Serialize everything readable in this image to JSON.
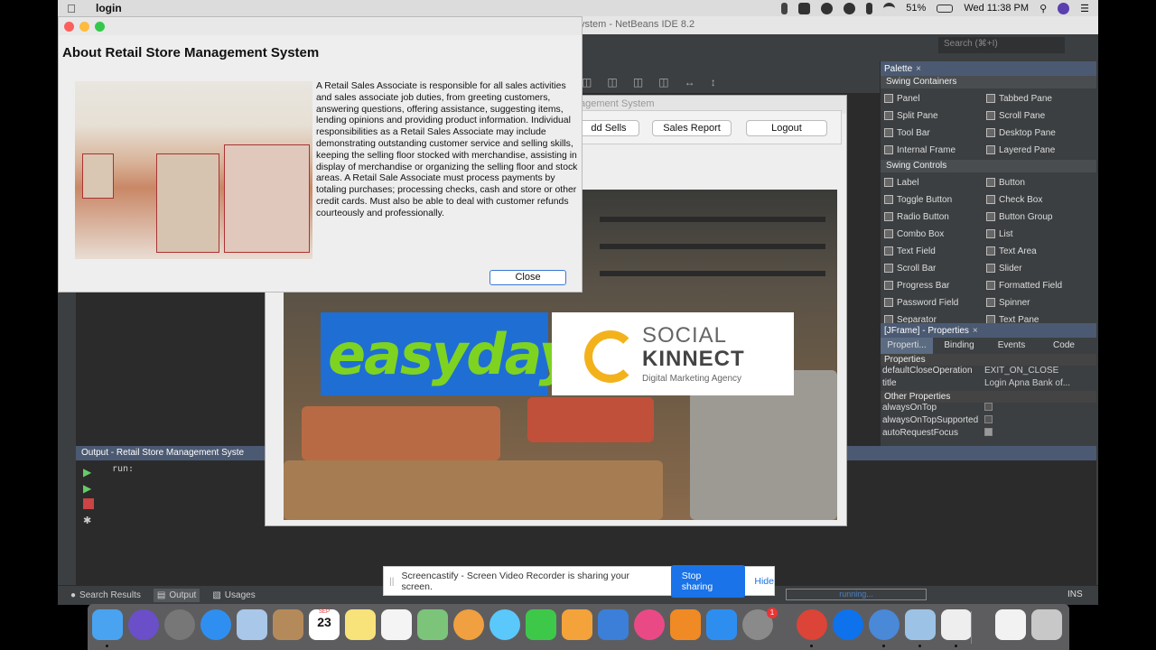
{
  "menubar": {
    "app_name": "login",
    "battery": "51%",
    "clock": "Wed 11:38 PM"
  },
  "ide": {
    "window_title": "ystem - NetBeans IDE 8.2",
    "search_placeholder": "Search (⌘+I)"
  },
  "palette": {
    "title": "Palette",
    "categories": [
      {
        "name": "Swing Containers",
        "items": [
          "Panel",
          "Tabbed Pane",
          "Split Pane",
          "Scroll Pane",
          "Tool Bar",
          "Desktop Pane",
          "Internal Frame",
          "Layered Pane"
        ]
      },
      {
        "name": "Swing Controls",
        "items": [
          "Label",
          "Button",
          "Toggle Button",
          "Check Box",
          "Radio Button",
          "Button Group",
          "Combo Box",
          "List",
          "Text Field",
          "Text Area",
          "Scroll Bar",
          "Slider",
          "Progress Bar",
          "Formatted Field",
          "Password Field",
          "Spinner",
          "Separator",
          "Text Pane"
        ]
      }
    ]
  },
  "properties": {
    "title": "[JFrame] - Properties",
    "tabs": [
      "Properti...",
      "Binding",
      "Events",
      "Code"
    ],
    "section_properties": "Properties",
    "rows": [
      {
        "key": "defaultCloseOperation",
        "value": "EXIT_ON_CLOSE"
      },
      {
        "key": "title",
        "value": "Login Apna Bank of..."
      }
    ],
    "section_other": "Other Properties",
    "other_rows": [
      "alwaysOnTop",
      "alwaysOnTopSupported",
      "autoRequestFocus"
    ]
  },
  "output": {
    "title": "Output - Retail Store Management Syste",
    "run_text": "run:"
  },
  "statusbar": {
    "tabs": [
      "Search Results",
      "Output",
      "Usages"
    ],
    "running": "running...",
    "mode": "INS"
  },
  "app": {
    "title": "agement System",
    "buttons": [
      "dd Sells",
      "Sales Report",
      "Logout"
    ],
    "easyday": "easyday",
    "social_line1": "SOCIAL",
    "social_line2": "KINNECT",
    "social_line3": "Digital Marketing Agency"
  },
  "about": {
    "heading": "About Retail Store Management System",
    "body": "A Retail Sales Associate is responsible for all sales activities and sales associate job duties, from greeting customers, answering questions, offering assistance, suggesting items, lending opinions and providing product information. Individual responsibilities as a Retail Sales Associate may include demonstrating outstanding customer service and selling skills, keeping the selling floor stocked with merchandise, assisting in display of merchandise or organizing the selling floor and stock areas. A Retail Sale Associate must process payments by totaling purchases; processing checks, cash and store or other credit cards. Must also be able to deal with customer refunds courteously and professionally.",
    "close_label": "Close"
  },
  "screencast": {
    "message": "Screencastify - Screen Video Recorder is sharing your screen.",
    "stop_label": "Stop sharing",
    "hide_label": "Hide"
  },
  "dock": {
    "calendar_day": "23",
    "calendar_month": "SEP",
    "badge": "1"
  }
}
